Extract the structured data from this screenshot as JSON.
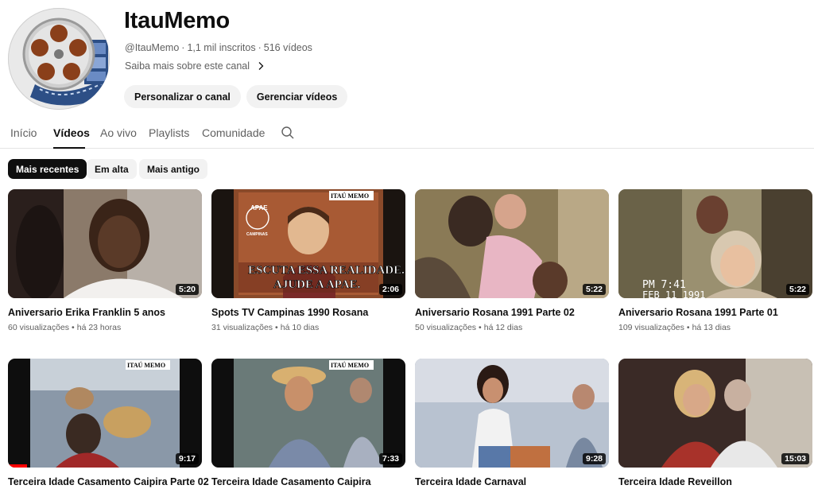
{
  "channel": {
    "name": "ItauMemo",
    "handle": "@ItauMemo",
    "subscribers": "1,1 mil inscritos",
    "video_count": "516 vídeos",
    "meta_separator": "·",
    "about_link": "Saiba mais sobre este canal",
    "buttons": {
      "customize": "Personalizar o canal",
      "manage": "Gerenciar vídeos"
    }
  },
  "tabs": [
    {
      "label": "Início",
      "active": false
    },
    {
      "label": "Vídeos",
      "active": true
    },
    {
      "label": "Ao vivo",
      "active": false
    },
    {
      "label": "Playlists",
      "active": false
    },
    {
      "label": "Comunidade",
      "active": false
    }
  ],
  "filters": [
    {
      "label": "Mais recentes",
      "active": true
    },
    {
      "label": "Em alta",
      "active": false
    },
    {
      "label": "Mais antigo",
      "active": false
    }
  ],
  "meta_dot": "•",
  "videos": [
    {
      "title": "Aniversario Erika Franklin 5 anos",
      "views": "60 visualizações",
      "age": "há 23 horas",
      "duration": "5:20"
    },
    {
      "title": "Spots TV Campinas 1990 Rosana",
      "views": "31 visualizações",
      "age": "há 10 dias",
      "duration": "2:06",
      "overlay": {
        "logo": "ITAÚ MEMO",
        "brand": "APAE",
        "brand_sub": "CAMPINAS",
        "caption_line1": "ESCUTA ESSA REALIDADE.",
        "caption_line2": "AJUDE A APAE."
      }
    },
    {
      "title": "Aniversario Rosana 1991 Parte 02",
      "views": "50 visualizações",
      "age": "há 12 dias",
      "duration": "5:22"
    },
    {
      "title": "Aniversario Rosana 1991 Parte 01",
      "views": "109 visualizações",
      "age": "há 13 dias",
      "duration": "5:22",
      "overlay": {
        "time": "PM 7:41",
        "date": "FEB 11 1991"
      }
    },
    {
      "title": "Terceira Idade Casamento Caipira Parte 02",
      "views": "",
      "age": "",
      "duration": "9:17",
      "watched_progress": 0.1,
      "overlay": {
        "logo": "ITAÚ MEMO"
      }
    },
    {
      "title": "Terceira Idade Casamento Caipira",
      "views": "",
      "age": "",
      "duration": "7:33",
      "overlay": {
        "logo": "ITAÚ MEMO"
      }
    },
    {
      "title": "Terceira Idade Carnaval",
      "views": "",
      "age": "",
      "duration": "9:28"
    },
    {
      "title": "Terceira Idade Reveillon",
      "views": "",
      "age": "",
      "duration": "15:03"
    }
  ]
}
